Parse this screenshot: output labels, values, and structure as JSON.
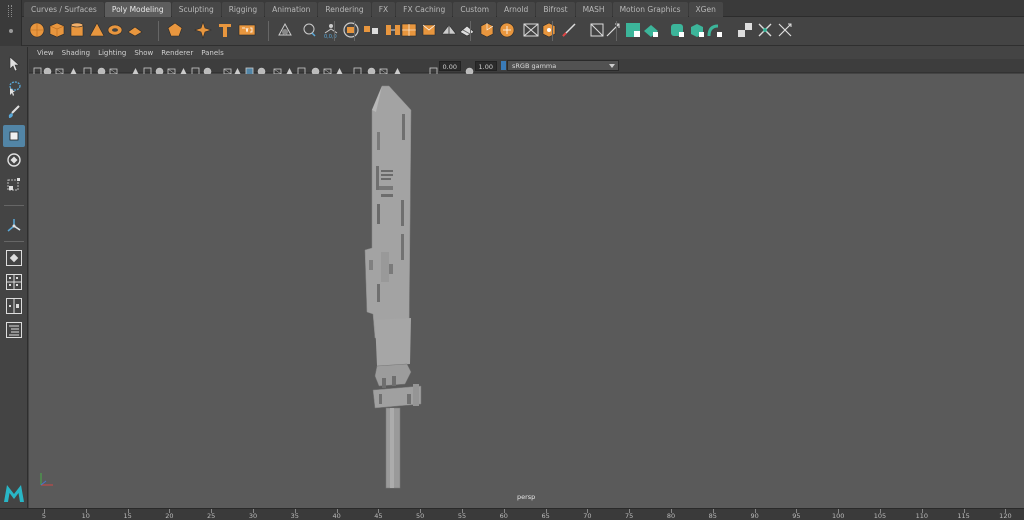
{
  "shelf": {
    "tabs": [
      "Curves / Surfaces",
      "Poly Modeling",
      "Sculpting",
      "Rigging",
      "Animation",
      "Rendering",
      "FX",
      "FX Caching",
      "Custom",
      "Arnold",
      "Bifrost",
      "MASH",
      "Motion Graphics",
      "XGen"
    ],
    "active_tab": "Poly Modeling",
    "icons": [
      "sphere-icon",
      "cube-icon",
      "cylinder-icon",
      "cone-icon",
      "torus-icon",
      "plane-icon",
      "platonic-icon",
      "star-icon",
      "text-tool-icon",
      "svg-icon",
      "sculpt-icon",
      "super-shape-icon",
      "combine-icon",
      "separate-icon",
      "mirror-icon",
      "bridge-icon",
      "smooth-icon",
      "reduce-icon",
      "triangulate-icon",
      "quadrangulate-icon",
      "bevel-icon",
      "extrude-icon",
      "wedge-icon",
      "poke-icon",
      "multi-cut-icon",
      "target-weld-icon",
      "connect-icon",
      "uv-layout-icon",
      "planar-map-icon",
      "cylindrical-map-icon",
      "spherical-map-icon",
      "auto-map-icon",
      "checker-icon",
      "sew-icon",
      "cut-uv-icon"
    ]
  },
  "toolbox": {
    "tools": [
      "select-tool-icon",
      "lasso-tool-icon",
      "paint-select-icon",
      "move-tool-icon",
      "rotate-tool-icon",
      "scale-tool-icon",
      "last-tool-icon",
      "single-pane-icon",
      "four-pane-icon",
      "two-pane-icon",
      "outliner-icon"
    ],
    "logo": "M"
  },
  "panel": {
    "menu": [
      "View",
      "Shading",
      "Lighting",
      "Show",
      "Renderer",
      "Panels"
    ],
    "exposure": "0.00",
    "gamma": "1.00",
    "color_management": "sRGB gamma"
  },
  "viewport": {
    "camera": "persp"
  },
  "timeline": {
    "ticks": [
      "5",
      "10",
      "15",
      "20",
      "25",
      "30",
      "35",
      "40",
      "45",
      "50",
      "55",
      "60",
      "65",
      "70",
      "75",
      "80",
      "85",
      "90",
      "95",
      "100",
      "105",
      "110",
      "115",
      "120"
    ]
  },
  "colors": {
    "accent": "#5285a6",
    "shelf_orange": "#e8963e",
    "shelf_teal": "#3cb59a",
    "viewport_bg": "#5a5a5a",
    "model": "#a3a3a3"
  }
}
